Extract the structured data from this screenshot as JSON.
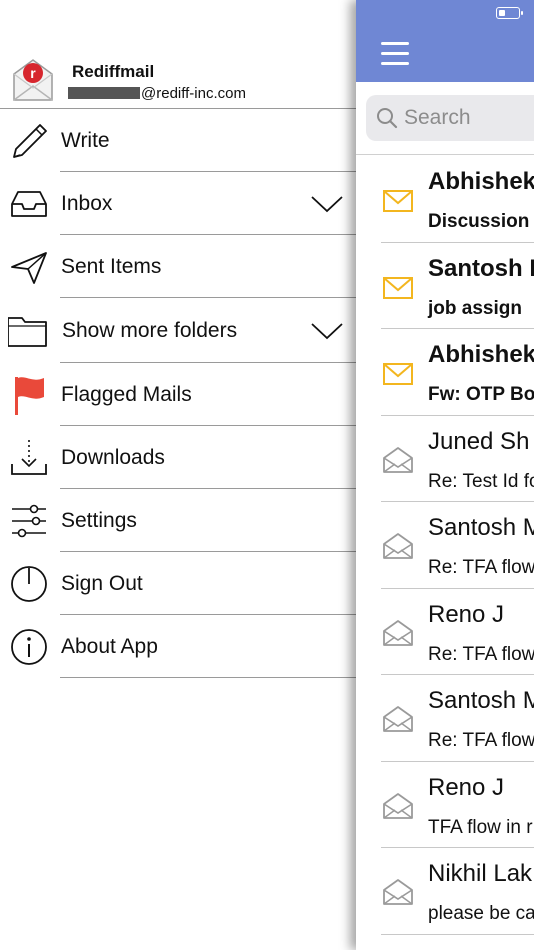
{
  "colors": {
    "accent": "#6f87d4",
    "unread_icon": "#f3b61f",
    "read_icon": "#9a9a9a",
    "flag": "#e9493a",
    "logo_red": "#d7262e"
  },
  "account": {
    "name": "Rediffmail",
    "email_visible": "@rediff-inc.com",
    "logo_icon": "rediff-envelope-logo"
  },
  "menu": [
    {
      "label": "Write",
      "icon": "pencil-icon"
    },
    {
      "label": "Inbox",
      "icon": "inbox-tray-icon",
      "expandable": true
    },
    {
      "label": "Sent Items",
      "icon": "paper-plane-icon"
    },
    {
      "label": "Show more folders",
      "icon": "folder-icon",
      "expandable": true
    },
    {
      "label": "Flagged Mails",
      "icon": "red-flag-icon"
    },
    {
      "label": "Downloads",
      "icon": "download-icon"
    },
    {
      "label": "Settings",
      "icon": "sliders-icon"
    },
    {
      "label": "Sign Out",
      "icon": "power-icon"
    },
    {
      "label": "About App",
      "icon": "info-icon"
    }
  ],
  "search": {
    "placeholder": "Search"
  },
  "messages": [
    {
      "sender": "Abhishek",
      "subject": "Discussion",
      "unread": true
    },
    {
      "sender": "Santosh I",
      "subject": "job assign",
      "unread": true
    },
    {
      "sender": "Abhishek",
      "subject": "Fw: OTP Bo",
      "unread": true
    },
    {
      "sender": "Juned Sh",
      "subject": "Re: Test Id fo",
      "unread": false
    },
    {
      "sender": "Santosh M",
      "subject": "Re: TFA flow",
      "unread": false
    },
    {
      "sender": "Reno J",
      "subject": "Re: TFA flow",
      "unread": false
    },
    {
      "sender": "Santosh M",
      "subject": "Re: TFA flow",
      "unread": false
    },
    {
      "sender": "Reno J",
      "subject": "TFA flow in r",
      "unread": false
    },
    {
      "sender": "Nikhil Lak",
      "subject": "please be ca",
      "unread": false
    }
  ]
}
